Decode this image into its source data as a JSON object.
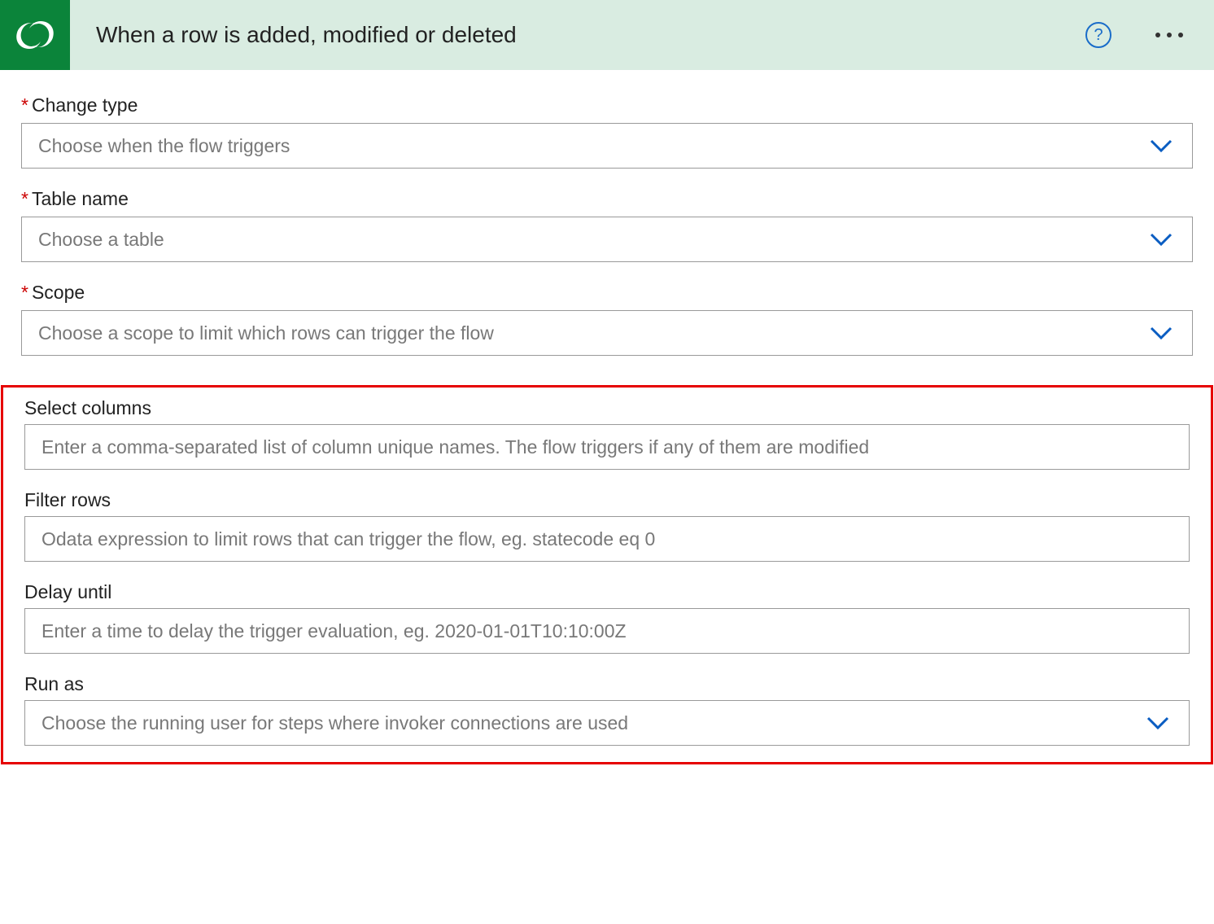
{
  "header": {
    "title": "When a row is added, modified or deleted",
    "help_icon": "?",
    "logo_color": "#0b843a"
  },
  "fields": {
    "change_type": {
      "label": "Change type",
      "required": true,
      "placeholder": "Choose when the flow triggers"
    },
    "table_name": {
      "label": "Table name",
      "required": true,
      "placeholder": "Choose a table"
    },
    "scope": {
      "label": "Scope",
      "required": true,
      "placeholder": "Choose a scope to limit which rows can trigger the flow"
    },
    "select_columns": {
      "label": "Select columns",
      "required": false,
      "placeholder": "Enter a comma-separated list of column unique names. The flow triggers if any of them are modified"
    },
    "filter_rows": {
      "label": "Filter rows",
      "required": false,
      "placeholder": "Odata expression to limit rows that can trigger the flow, eg. statecode eq 0"
    },
    "delay_until": {
      "label": "Delay until",
      "required": false,
      "placeholder": "Enter a time to delay the trigger evaluation, eg. 2020-01-01T10:10:00Z"
    },
    "run_as": {
      "label": "Run as",
      "required": false,
      "placeholder": "Choose the running user for steps where invoker connections are used"
    }
  },
  "required_marker": "*"
}
